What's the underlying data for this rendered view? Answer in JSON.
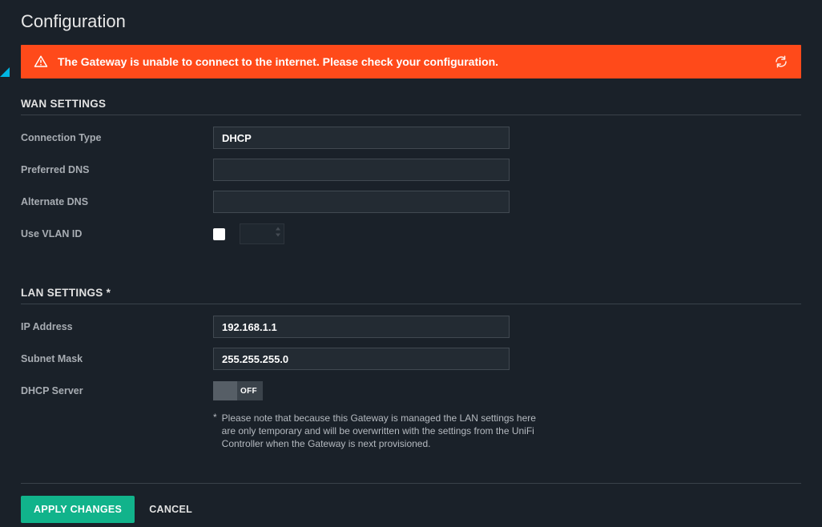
{
  "page": {
    "title": "Configuration"
  },
  "alert": {
    "message": "The Gateway is unable to connect to the internet. Please check your configuration."
  },
  "wan": {
    "heading": "WAN SETTINGS",
    "connection_type_label": "Connection Type",
    "connection_type_value": "DHCP",
    "preferred_dns_label": "Preferred DNS",
    "preferred_dns_value": "",
    "alternate_dns_label": "Alternate DNS",
    "alternate_dns_value": "",
    "use_vlan_label": "Use VLAN ID",
    "use_vlan_checked": false,
    "vlan_value": ""
  },
  "lan": {
    "heading": "LAN SETTINGS *",
    "ip_label": "IP Address",
    "ip_value": "192.168.1.1",
    "subnet_label": "Subnet Mask",
    "subnet_value": "255.255.255.0",
    "dhcp_server_label": "DHCP Server",
    "dhcp_server_state": "OFF",
    "note_marker": "*",
    "note": "Please note that because this Gateway is managed the LAN settings here are only temporary and will be overwritten with the settings from the UniFi Controller when the Gateway is next provisioned."
  },
  "footer": {
    "apply": "APPLY CHANGES",
    "cancel": "CANCEL"
  },
  "colors": {
    "alert_bg": "#ff4a1a",
    "primary_btn": "#11b38b",
    "accent": "#00b5e2"
  }
}
